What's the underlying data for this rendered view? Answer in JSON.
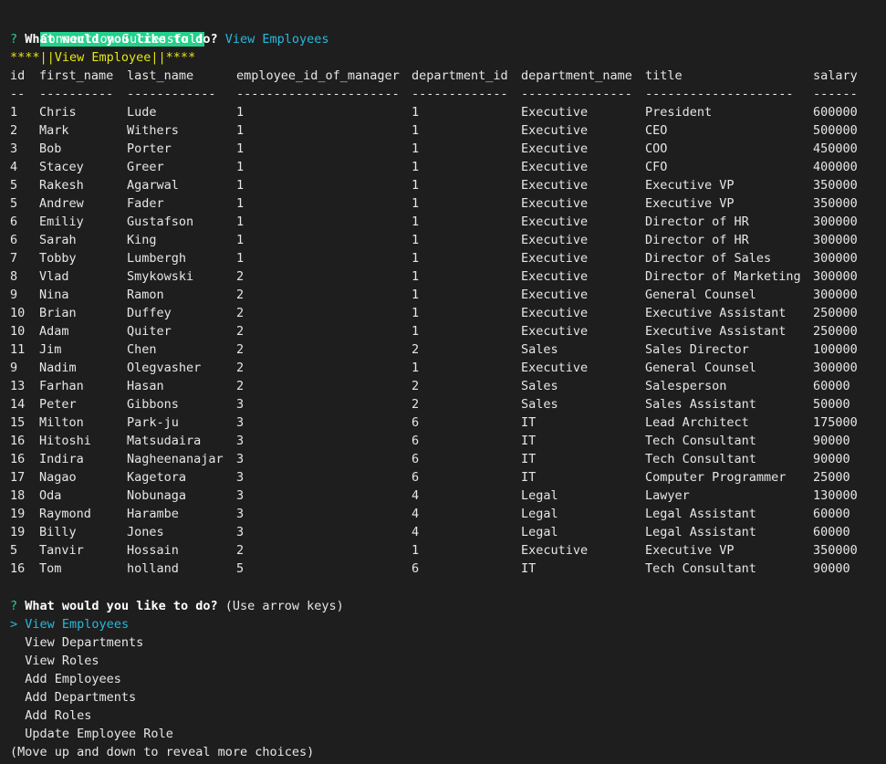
{
  "status": {
    "connection_message": "Connection Successful!"
  },
  "prompt1": {
    "marker": "?",
    "question": "What would you like to do?",
    "answer": "View Employees"
  },
  "banner": "****||View Employee||****",
  "table": {
    "headers": [
      "id",
      "first_name",
      "last_name",
      "employee_id_of_manager",
      "department_id",
      "department_name",
      "title",
      "salary"
    ],
    "separators": [
      "--",
      "----------",
      "------------",
      "----------------------",
      "-------------",
      "---------------",
      "--------------------",
      "------"
    ],
    "rows": [
      [
        "1",
        "Chris",
        "Lude",
        "1",
        "1",
        "Executive",
        "President",
        "600000"
      ],
      [
        "2",
        "Mark",
        "Withers",
        "1",
        "1",
        "Executive",
        "CEO",
        "500000"
      ],
      [
        "3",
        "Bob",
        "Porter",
        "1",
        "1",
        "Executive",
        "COO",
        "450000"
      ],
      [
        "4",
        "Stacey",
        "Greer",
        "1",
        "1",
        "Executive",
        "CFO",
        "400000"
      ],
      [
        "5",
        "Rakesh",
        "Agarwal",
        "1",
        "1",
        "Executive",
        "Executive VP",
        "350000"
      ],
      [
        "5",
        "Andrew",
        "Fader",
        "1",
        "1",
        "Executive",
        "Executive VP",
        "350000"
      ],
      [
        "6",
        "Emiliy",
        "Gustafson",
        "1",
        "1",
        "Executive",
        "Director of HR",
        "300000"
      ],
      [
        "6",
        "Sarah",
        "King",
        "1",
        "1",
        "Executive",
        "Director of HR",
        "300000"
      ],
      [
        "7",
        "Tobby",
        "Lumbergh",
        "1",
        "1",
        "Executive",
        "Director of Sales",
        "300000"
      ],
      [
        "8",
        "Vlad",
        "Smykowski",
        "2",
        "1",
        "Executive",
        "Director of Marketing",
        "300000"
      ],
      [
        "9",
        "Nina",
        "Ramon",
        "2",
        "1",
        "Executive",
        "General Counsel",
        "300000"
      ],
      [
        "10",
        "Brian",
        "Duffey",
        "2",
        "1",
        "Executive",
        "Executive Assistant",
        "250000"
      ],
      [
        "10",
        "Adam",
        "Quiter",
        "2",
        "1",
        "Executive",
        "Executive Assistant",
        "250000"
      ],
      [
        "11",
        "Jim",
        "Chen",
        "2",
        "2",
        "Sales",
        "Sales Director",
        "100000"
      ],
      [
        "9",
        "Nadim",
        "Olegvasher",
        "2",
        "1",
        "Executive",
        "General Counsel",
        "300000"
      ],
      [
        "13",
        "Farhan",
        "Hasan",
        "2",
        "2",
        "Sales",
        "Salesperson",
        "60000"
      ],
      [
        "14",
        "Peter",
        "Gibbons",
        "3",
        "2",
        "Sales",
        "Sales Assistant",
        "50000"
      ],
      [
        "15",
        "Milton",
        "Park-ju",
        "3",
        "6",
        "IT",
        "Lead Architect",
        "175000"
      ],
      [
        "16",
        "Hitoshi",
        "Matsudaira",
        "3",
        "6",
        "IT",
        "Tech Consultant",
        "90000"
      ],
      [
        "16",
        "Indira",
        "Nagheenanajar",
        "3",
        "6",
        "IT",
        "Tech Consultant",
        "90000"
      ],
      [
        "17",
        "Nagao",
        "Kagetora",
        "3",
        "6",
        "IT",
        "Computer Programmer",
        "25000"
      ],
      [
        "18",
        "Oda",
        "Nobunaga",
        "3",
        "4",
        "Legal",
        "Lawyer",
        "130000"
      ],
      [
        "19",
        "Raymond",
        "Harambe",
        "3",
        "4",
        "Legal",
        "Legal Assistant",
        "60000"
      ],
      [
        "19",
        "Billy",
        "Jones",
        "3",
        "4",
        "Legal",
        "Legal Assistant",
        "60000"
      ],
      [
        "5",
        "Tanvir",
        "Hossain",
        "2",
        "1",
        "Executive",
        "Executive VP",
        "350000"
      ],
      [
        "16",
        "Tom",
        "holland",
        "5",
        "6",
        "IT",
        "Tech Consultant",
        "90000"
      ]
    ]
  },
  "prompt2": {
    "marker": "?",
    "question": "What would you like to do?",
    "hint": "(Use arrow keys)",
    "pointer": ">",
    "choices": [
      "View Employees",
      "View Departments",
      "View Roles",
      "Add Employees",
      "Add Departments",
      "Add Roles",
      "Update Employee Role"
    ],
    "footer": "(Move up and down to reveal more choices)"
  },
  "colors": {
    "background": "#1e1e1e",
    "text": "#e6e6e6",
    "success_bg": "#23d18b",
    "answer": "#29b8db",
    "banner": "#e5e510"
  }
}
